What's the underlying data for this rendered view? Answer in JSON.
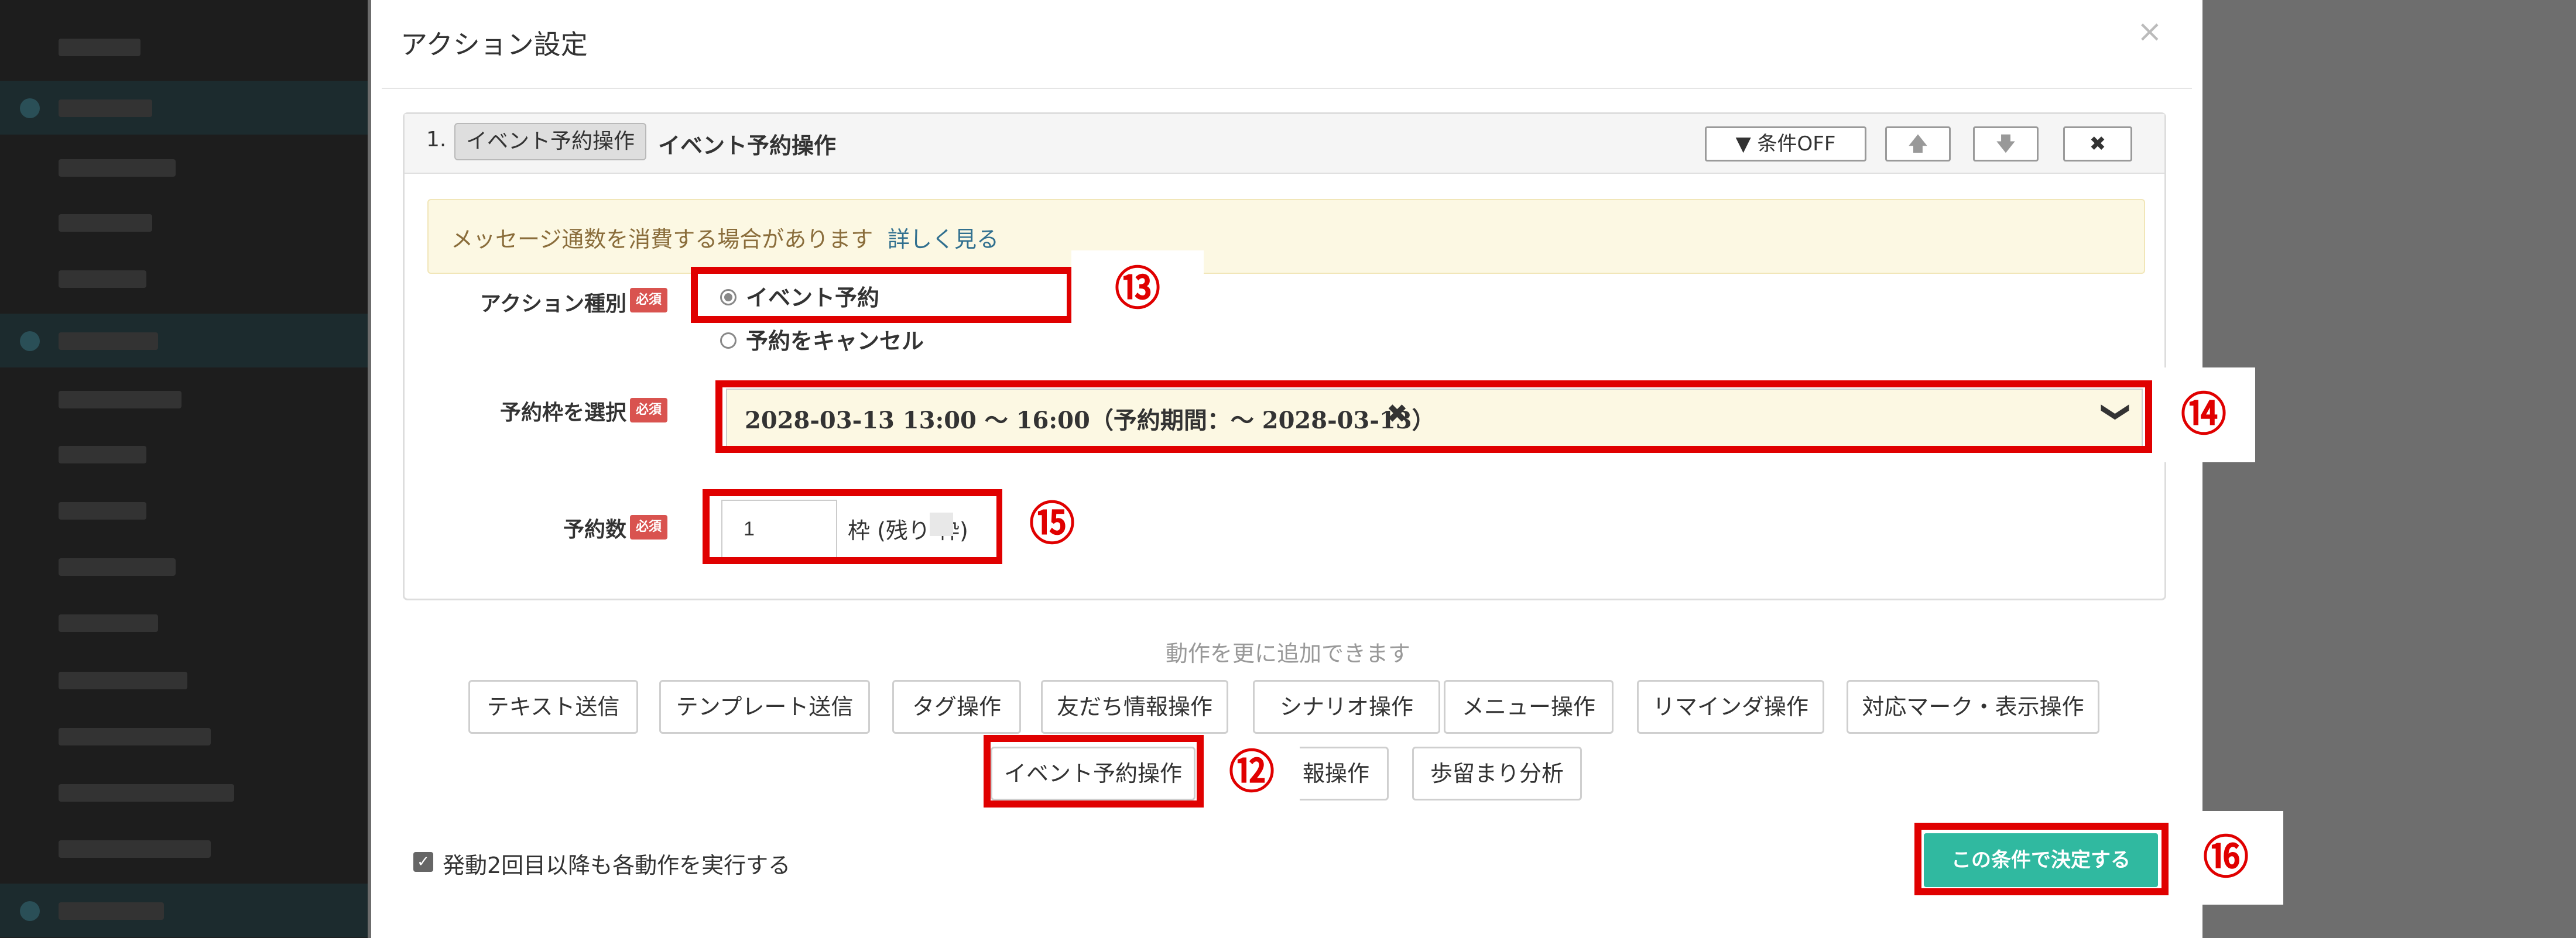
{
  "modal": {
    "title": "アクション設定",
    "close": "×"
  },
  "action": {
    "number": "1.",
    "tag": "イベント予約操作",
    "name": "イベント予約操作",
    "condition_button": "▼ 条件OFF",
    "up_button": "🡅",
    "down_button": "🡇",
    "delete_button": "✖"
  },
  "notice": {
    "text": "メッセージ通数を消費する場合があります",
    "link": "詳しく見る"
  },
  "required_badge": "必須",
  "fields": {
    "action_type": {
      "label": "アクション種別",
      "options": [
        "イベント予約",
        "予約をキャンセル"
      ],
      "selected": "イベント予約"
    },
    "slot": {
      "label": "予約枠を選択",
      "value": "2028-03-13 13:00 ～ 16:00（予約期間：～ 2028-03-13）",
      "clear": "✖",
      "chevron": "❯"
    },
    "count": {
      "label": "予約数",
      "value": "1",
      "unit": "枠 (残り    枠)"
    }
  },
  "add_actions": {
    "hint": "動作を更に追加できます",
    "buttons": [
      "テキスト送信",
      "テンプレート送信",
      "タグ操作",
      "友だち情報操作",
      "シナリオ操作",
      "メニュー操作",
      "リマインダ操作",
      "対応マーク・表示操作",
      "イベント予約操作",
      "報操作",
      "歩留まり分析"
    ]
  },
  "footer": {
    "checkbox_label": "発動2回目以降も各動作を実行する",
    "checkbox_checked": true,
    "submit": "この条件で決定する"
  },
  "callouts": {
    "c12": "⑫",
    "c13": "⑬",
    "c14": "⑭",
    "c15": "⑮",
    "c16": "⑯"
  },
  "colors": {
    "highlight": "#e00000",
    "submit": "#30b9a0",
    "required": "#d9534f",
    "notice_bg": "#fcf8e3"
  }
}
